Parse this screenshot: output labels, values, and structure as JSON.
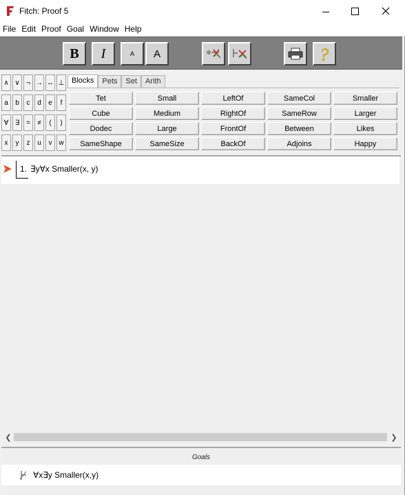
{
  "window": {
    "title": "Fitch: Proof 5",
    "controls": {
      "minimize": "minimize",
      "maximize": "maximize",
      "close": "✕"
    }
  },
  "menu": [
    "File",
    "Edit",
    "Proof",
    "Goal",
    "Window",
    "Help"
  ],
  "toolbar": {
    "bold_label": "B",
    "italic_label": "I",
    "small_font_label": "A",
    "large_font_label": "A",
    "help_label": "?"
  },
  "keypad": [
    [
      "∧",
      "∨",
      "¬",
      "→",
      "↔",
      "⊥"
    ],
    [
      "a",
      "b",
      "c",
      "d",
      "e",
      "f"
    ],
    [
      "∀",
      "∃",
      "=",
      "≠",
      "(",
      ")"
    ],
    [
      "x",
      "y",
      "z",
      "u",
      "v",
      "w"
    ]
  ],
  "predicate_tabs": [
    "Blocks",
    "Pets",
    "Set",
    "Arith"
  ],
  "active_tab": "Blocks",
  "predicates": [
    [
      "Tet",
      "Small",
      "LeftOf",
      "SameCol",
      "Smaller"
    ],
    [
      "Cube",
      "Medium",
      "RightOf",
      "SameRow",
      "Larger"
    ],
    [
      "Dodec",
      "Large",
      "FrontOf",
      "Between",
      "Likes"
    ],
    [
      "SameShape",
      "SameSize",
      "BackOf",
      "Adjoins",
      "Happy"
    ]
  ],
  "proof": {
    "steps": [
      {
        "number": "1.",
        "formula": "∃y∀x Smaller(x, y)"
      }
    ]
  },
  "goals": {
    "header": "Goals",
    "items": [
      {
        "formula": "∀x∃y Smaller(x,y)"
      }
    ]
  },
  "colors": {
    "toolbar_bg": "#7f7f7f",
    "accent_red": "#c0292b",
    "arrow_orange": "#e0572a",
    "help_yellow": "#f2c230"
  },
  "icons": {
    "app": "fitch-logo-icon",
    "step_pointer": "play-arrow-icon",
    "goal_status": "turnstile-icon",
    "print": "printer-icon",
    "help": "question-mark-icon",
    "tool1": "check-rule-icon",
    "tool2": "cite-support-icon"
  }
}
